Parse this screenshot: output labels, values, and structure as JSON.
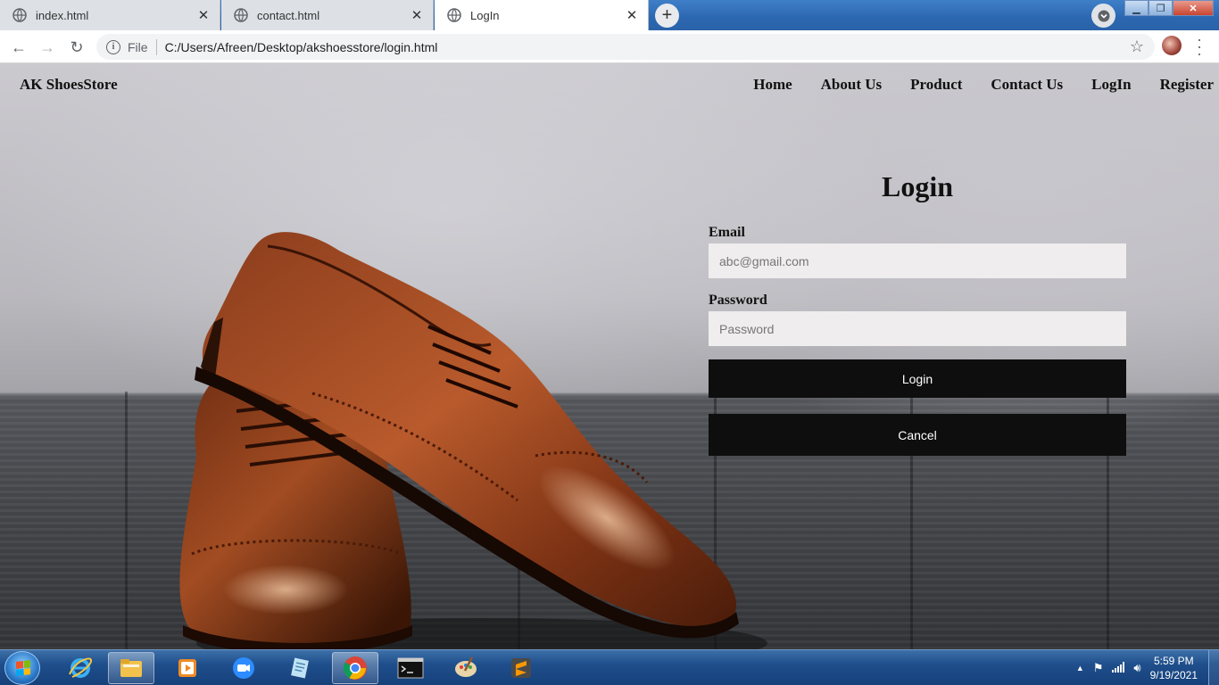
{
  "browser": {
    "tabs": [
      {
        "title": "index.html",
        "active": false
      },
      {
        "title": "contact.html",
        "active": false
      },
      {
        "title": "LogIn",
        "active": true
      }
    ],
    "address": {
      "scheme_label": "File",
      "url": "C:/Users/Afreen/Desktop/akshoesstore/login.html"
    }
  },
  "site": {
    "brand": "AK ShoesStore",
    "nav": [
      "Home",
      "About Us",
      "Product",
      "Contact Us",
      "LogIn",
      "Register"
    ]
  },
  "login": {
    "title": "Login",
    "email_label": "Email",
    "email_placeholder": "abc@gmail.com",
    "password_label": "Password",
    "password_placeholder": "Password",
    "login_button": "Login",
    "cancel_button": "Cancel"
  },
  "taskbar": {
    "time": "5:59 PM",
    "date": "9/19/2021",
    "apps": [
      "internet-explorer-icon",
      "file-explorer-icon",
      "media-player-icon",
      "zoom-icon",
      "notepad-icon",
      "chrome-icon",
      "command-prompt-icon",
      "paint-icon",
      "sublime-text-icon"
    ]
  }
}
